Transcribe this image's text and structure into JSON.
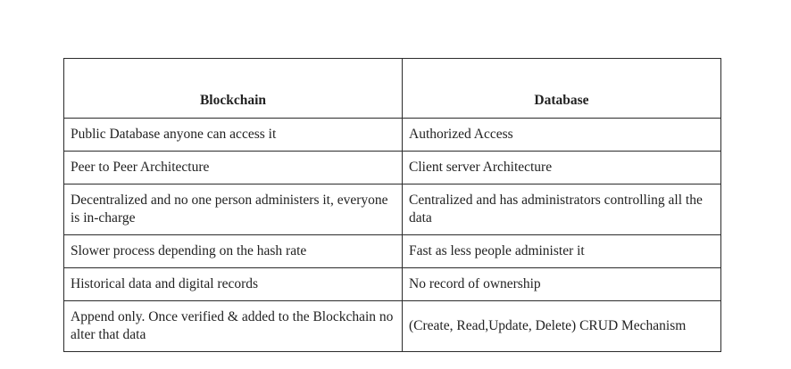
{
  "table": {
    "headers": [
      "Blockchain",
      "Database"
    ],
    "rows": [
      [
        "Public Database anyone can access it",
        "Authorized Access"
      ],
      [
        "Peer to Peer Architecture",
        "Client server Architecture"
      ],
      [
        "Decentralized and no one person administers it, everyone is in-charge",
        "Centralized and has  administrators controlling all the data"
      ],
      [
        "Slower process depending on the hash rate",
        "Fast as less people administer it"
      ],
      [
        "Historical data and digital records",
        "No record of ownership"
      ],
      [
        "Append only. Once verified & added to the Blockchain no alter that data",
        "(Create, Read,Update, Delete) CRUD Mechanism"
      ]
    ]
  }
}
